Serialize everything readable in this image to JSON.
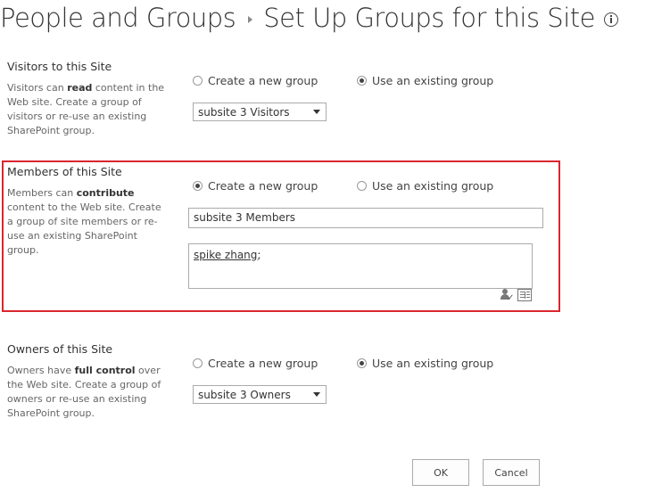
{
  "header": {
    "title_part1": "People and Groups",
    "title_part2": "Set Up Groups for this Site"
  },
  "visitors": {
    "title": "Visitors to this Site",
    "desc_prefix": "Visitors can ",
    "desc_bold": "read",
    "desc_suffix": " content in the Web site. Create a group of visitors or re-use an existing SharePoint group.",
    "option_new": "Create a new group",
    "option_existing": "Use an existing group",
    "selected_option": "existing",
    "select_value": "subsite 3 Visitors"
  },
  "members": {
    "title": "Members of this Site",
    "desc_prefix": "Members can ",
    "desc_bold": "contribute",
    "desc_suffix": " content to the Web site. Create a group of site members or re-use an existing SharePoint group.",
    "option_new": "Create a new group",
    "option_existing": "Use an existing group",
    "selected_option": "new",
    "group_name_value": "subsite 3 Members",
    "people_value": "spike zhang",
    "people_separator": ";"
  },
  "owners": {
    "title": "Owners of this Site",
    "desc_prefix": "Owners have ",
    "desc_bold": "full control",
    "desc_suffix": " over the Web site. Create a group of owners or re-use an existing SharePoint group.",
    "option_new": "Create a new group",
    "option_existing": "Use an existing group",
    "selected_option": "existing",
    "select_value": "subsite 3 Owners"
  },
  "buttons": {
    "ok": "OK",
    "cancel": "Cancel"
  },
  "colors": {
    "highlight_border": "#d9262e"
  }
}
